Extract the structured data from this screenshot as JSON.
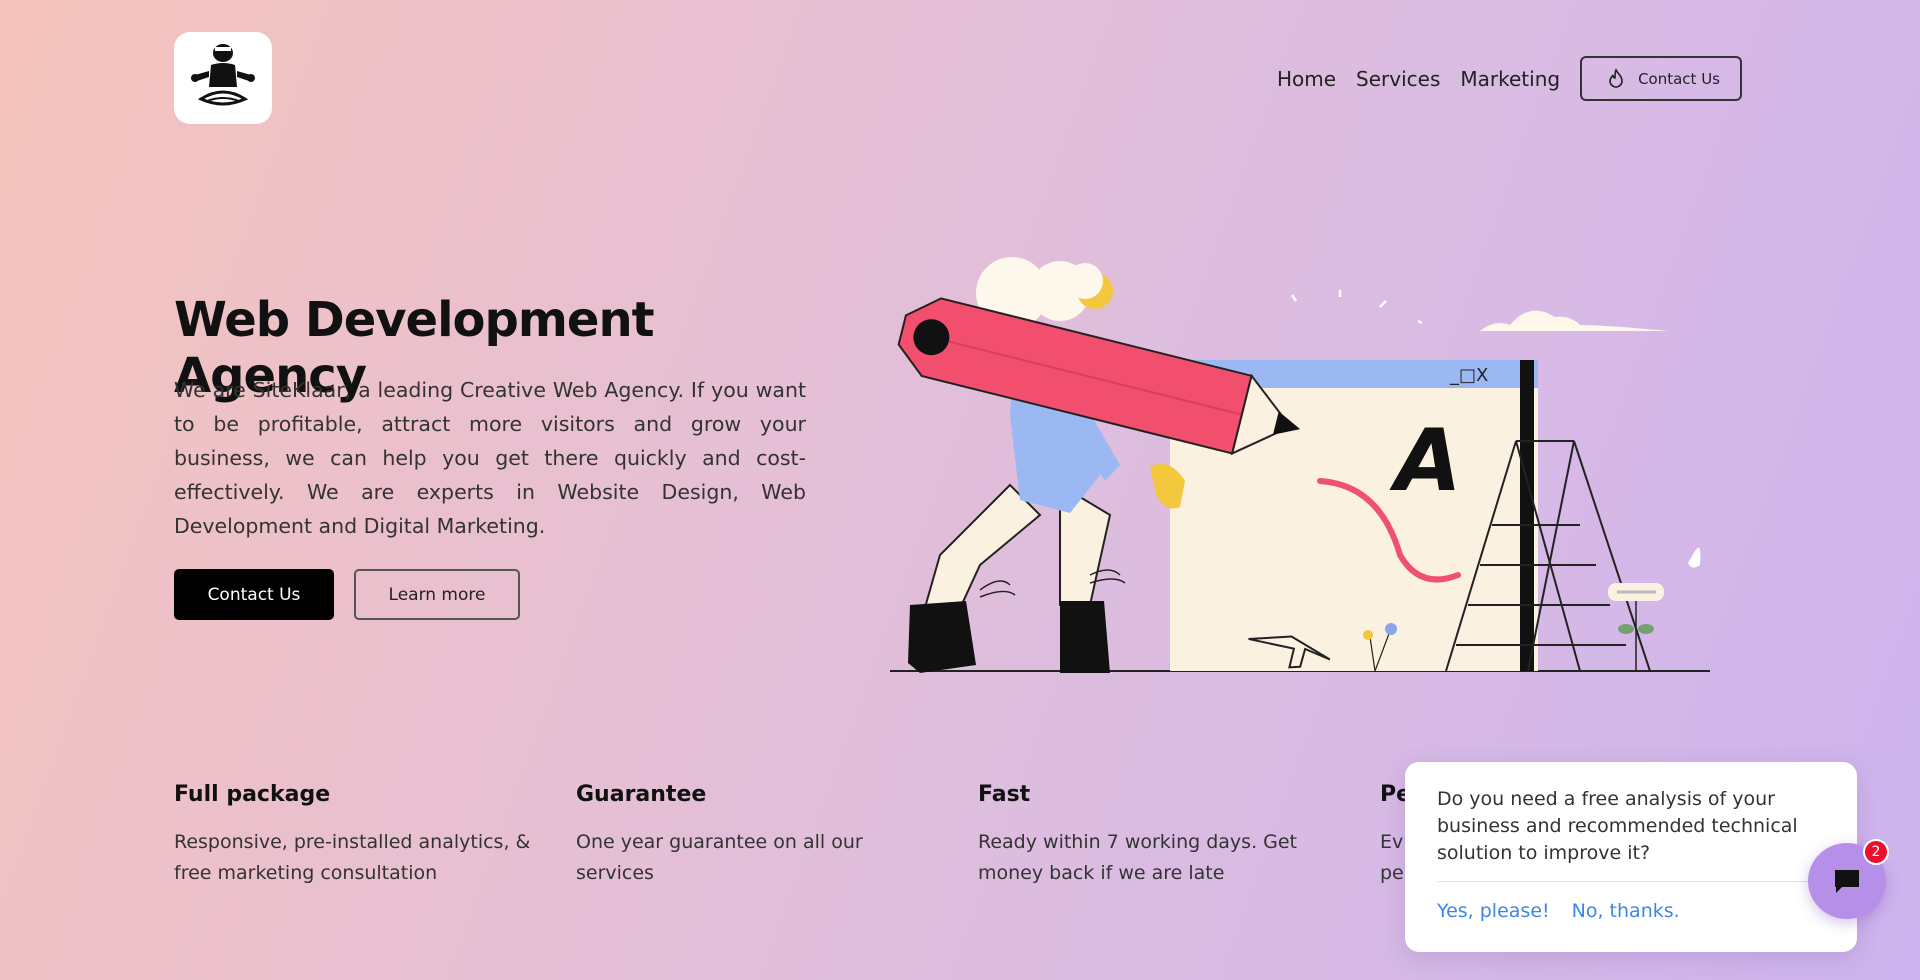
{
  "nav": {
    "items": [
      "Home",
      "Services",
      "Marketing"
    ],
    "contact_label": "Contact Us"
  },
  "hero": {
    "title": "Web Development Agency",
    "body": "We are SiteKlaar, a leading Creative Web Agency. If you want to be profitable, attract more visitors and grow your business, we can help you get there quickly and cost-effectively. We are experts in Website Design, Web Development and Digital Marketing.",
    "primary_button": "Contact Us",
    "secondary_button": "Learn more"
  },
  "illustration": {
    "window_controls": "_□X",
    "canvas_letter": "A"
  },
  "features": [
    {
      "title": "Full package",
      "text": "Responsive, pre-installed analytics, & free marketing consultation"
    },
    {
      "title": "Guarantee",
      "text": "One year guarantee on all our services"
    },
    {
      "title": "Fast",
      "text": "Ready within 7 working days. Get money back if we are late"
    },
    {
      "title": "Pe",
      "text": "Ev pe"
    }
  ],
  "chat_popup": {
    "message": "Do you need a free analysis of your business and recommended technical solution to improve it?",
    "yes_label": "Yes, please!",
    "no_label": "No, thanks.",
    "badge_count": "2"
  },
  "colors": {
    "accent_link": "#3d86e8",
    "badge_red": "#e8102e",
    "chat_purple": "#b690e8"
  }
}
